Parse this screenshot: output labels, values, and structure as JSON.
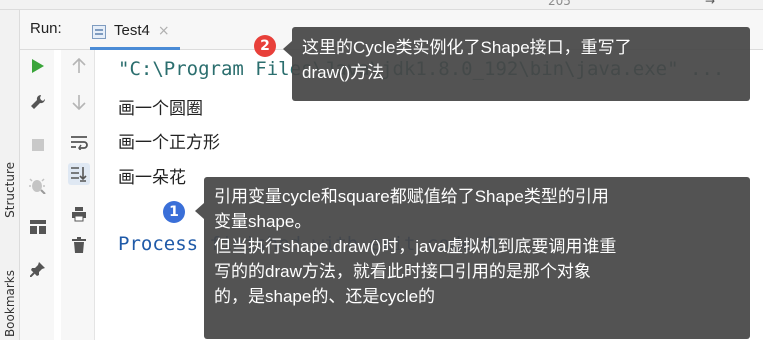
{
  "top_fragment": {
    "left": "205",
    "right": "→"
  },
  "side_tabs": {
    "structure": "Structure",
    "bookmarks": "Bookmarks"
  },
  "run_panel": {
    "label": "Run:",
    "tab": {
      "label": "Test4",
      "close": "×"
    }
  },
  "console": {
    "command": "\"C:\\Program Files\\Java\\jdk1.8.0_192\\bin\\java.exe\" ...",
    "output": [
      "画一个圆圈",
      "画一个正方形",
      "画一朵花"
    ],
    "finish": "Process finished with exit code 0"
  },
  "annotations": [
    {
      "number": "2",
      "lines": [
        "这里的Cycle类实例化了Shape接口，重写了",
        "draw()方法"
      ]
    },
    {
      "number": "1",
      "lines": [
        "引用变量cycle和square都赋值给了Shape类型的引用",
        "变量shape。",
        "但当执行shape.draw()时，java虚拟机到底要调用谁重",
        "写的的draw方法，就看此时接口引用的是那个对象",
        "的，是shape的、还是cycle的"
      ]
    }
  ],
  "icons": {
    "left_column": [
      "run-icon",
      "wrench-icon",
      "stop-icon",
      "debug-icon",
      "layout-icon",
      "pin-icon"
    ],
    "right_column": [
      "up-arrow-icon",
      "down-arrow-icon",
      "soft-wrap-icon",
      "scroll-to-end-icon",
      "print-icon",
      "trash-icon"
    ]
  },
  "colors": {
    "run_green": "#3aa53a",
    "tab_accent": "#4a8bd6",
    "badge_red": "#e8403a",
    "badge_blue": "#3a6fd8",
    "command_text": "#2b6e6e",
    "finish_text": "#1f5aa8"
  }
}
